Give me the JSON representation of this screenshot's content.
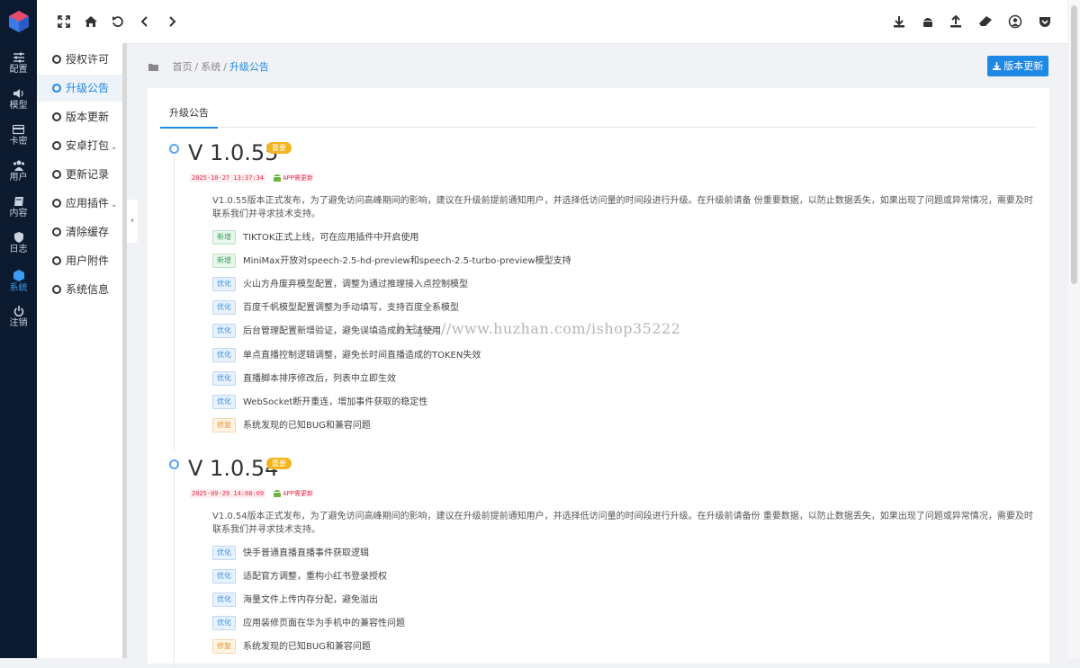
{
  "rail": {
    "items": [
      {
        "label": "配置",
        "icon": "sliders-icon"
      },
      {
        "label": "模型",
        "icon": "volume-icon"
      },
      {
        "label": "卡密",
        "icon": "card-icon"
      },
      {
        "label": "用户",
        "icon": "users-icon"
      },
      {
        "label": "内容",
        "icon": "book-icon"
      },
      {
        "label": "日志",
        "icon": "shield-icon"
      },
      {
        "label": "系统",
        "icon": "cube-icon"
      },
      {
        "label": "注销",
        "icon": "power-icon"
      }
    ],
    "active_index": 6
  },
  "topbar": {
    "left_icons": [
      "fullscreen-icon",
      "home-icon",
      "refresh-icon",
      "back-icon",
      "forward-icon"
    ],
    "right_icons": [
      "download-icon",
      "android-icon",
      "upload-icon",
      "eraser-icon",
      "user-icon",
      "pocket-icon"
    ]
  },
  "subnav": {
    "items": [
      {
        "label": "授权许可"
      },
      {
        "label": "升级公告",
        "active": true
      },
      {
        "label": "版本更新"
      },
      {
        "label": "安卓打包",
        "has_children": true
      },
      {
        "label": "更新记录"
      },
      {
        "label": "应用插件",
        "has_children": true
      },
      {
        "label": "清除缓存"
      },
      {
        "label": "用户附件"
      },
      {
        "label": "系统信息"
      }
    ]
  },
  "breadcrumb": {
    "home": "首页",
    "section": "系统",
    "current": "升级公告",
    "separator": "/"
  },
  "version_update_button": "版本更新",
  "tab": {
    "label": "升级公告"
  },
  "releases": [
    {
      "version": "V 1.0.55",
      "badge": "重要",
      "datetime": "2025-10-27 13:37:34",
      "app_note": "APP需更新",
      "description": "V1.0.55版本正式发布，为了避免访问高峰期间的影响，建议在升级前提前通知用户，并选择低访问量的时间段进行升级。在升级前请备 份重要数据，以防止数据丢失，如果出现了问题或异常情况，需要及时联系我们并寻求技术支持。",
      "changes": [
        {
          "tag": "新增",
          "type": "new",
          "text": "TIKTOK正式上线，可在应用插件中开启使用"
        },
        {
          "tag": "新增",
          "type": "new",
          "text": "MiniMax开放对speech-2.5-hd-preview和speech-2.5-turbo-preview模型支持"
        },
        {
          "tag": "优化",
          "type": "opt",
          "text": "火山方舟废弃模型配置，调整为通过推理接入点控制模型"
        },
        {
          "tag": "优化",
          "type": "opt",
          "text": "百度千帆模型配置调整为手动填写，支持百度全系模型"
        },
        {
          "tag": "优化",
          "type": "opt",
          "text": "后台管理配置新增验证，避免误填造成的无法使用"
        },
        {
          "tag": "优化",
          "type": "opt",
          "text": "单点直播控制逻辑调整，避免长时间直播造成的TOKEN失效"
        },
        {
          "tag": "优化",
          "type": "opt",
          "text": "直播脚本排序修改后，列表中立即生效"
        },
        {
          "tag": "优化",
          "type": "opt",
          "text": "WebSocket断开重连，增加事件获取的稳定性"
        },
        {
          "tag": "修复",
          "type": "fix",
          "text": "系统发现的已知BUG和兼容问题"
        }
      ]
    },
    {
      "version": "V 1.0.54",
      "badge": "重要",
      "datetime": "2025-09-29 14:08:09",
      "app_note": "APP需更新",
      "description": "V1.0.54版本正式发布，为了避免访问高峰期间的影响，建议在升级前提前通知用户，并选择低访问量的时间段进行升级。在升级前请备份 重要数据，以防止数据丢失，如果出现了问题或异常情况，需要及时联系我们并寻求技术支持。",
      "changes": [
        {
          "tag": "优化",
          "type": "opt",
          "text": "快手普通直播直播事件获取逻辑"
        },
        {
          "tag": "优化",
          "type": "opt",
          "text": "适配官方调整，重构小红书登录授权"
        },
        {
          "tag": "优化",
          "type": "opt",
          "text": "海量文件上传内存分配，避免溢出"
        },
        {
          "tag": "优化",
          "type": "opt",
          "text": "应用装修页面在华为手机中的兼容性问题"
        },
        {
          "tag": "修复",
          "type": "fix",
          "text": "系统发现的已知BUG和兼容问题"
        }
      ]
    }
  ],
  "watermark": "https://www.huzhan.com/ishop35222",
  "colors": {
    "accent": "#1e88e5",
    "rail_bg": "#0b1a2e",
    "badge": "#f5b41f"
  }
}
